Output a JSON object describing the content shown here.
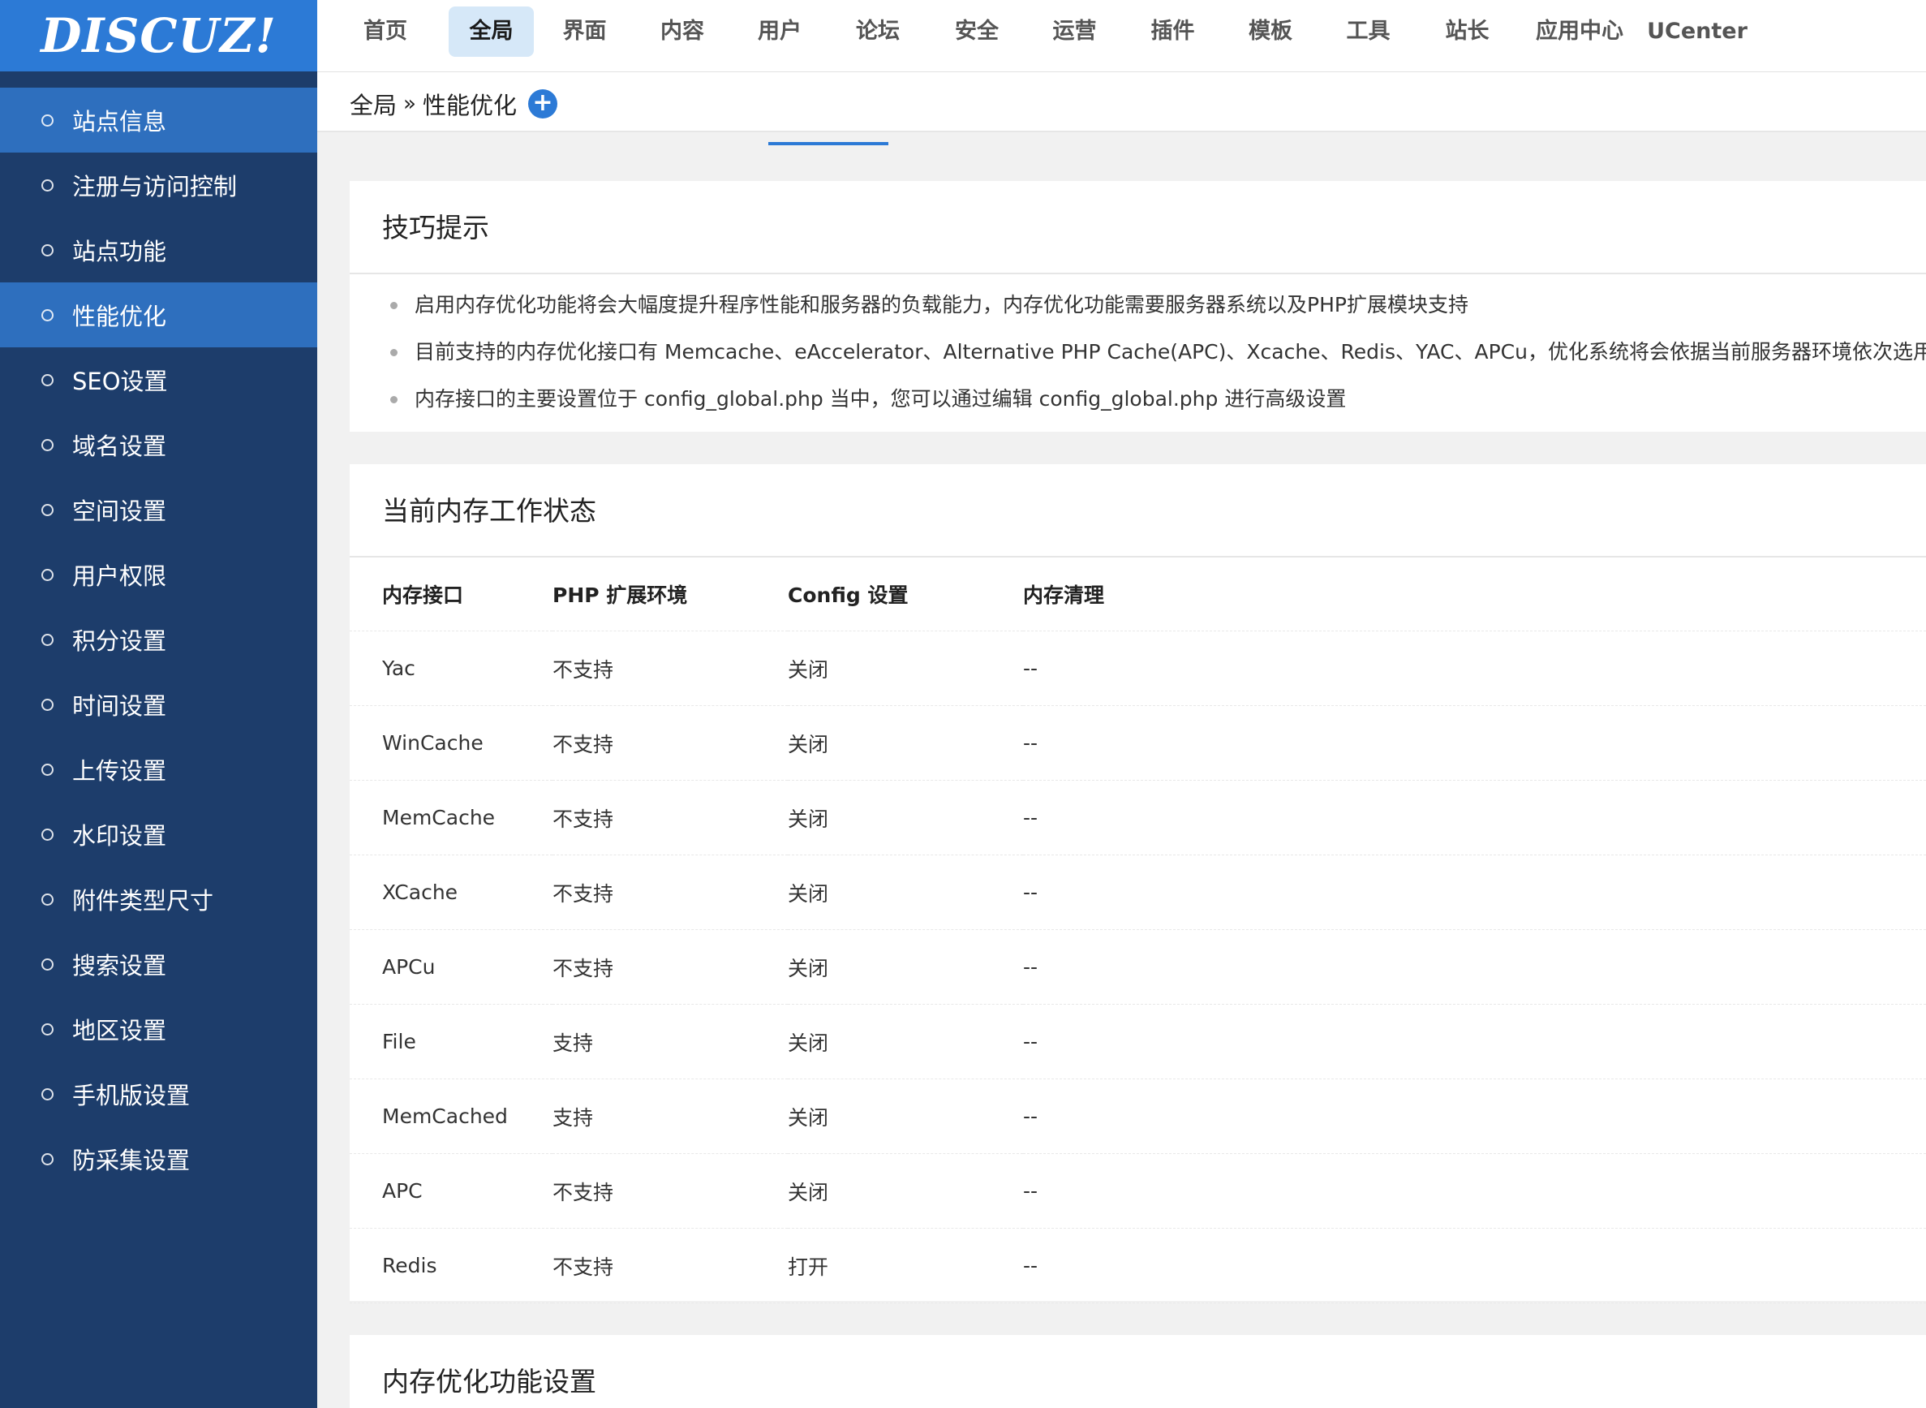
{
  "logo": "DISCUZ!",
  "top_nav": [
    {
      "label": "首页",
      "active": false
    },
    {
      "label": "全局",
      "active": true
    },
    {
      "label": "界面",
      "active": false
    },
    {
      "label": "内容",
      "active": false
    },
    {
      "label": "用户",
      "active": false
    },
    {
      "label": "论坛",
      "active": false
    },
    {
      "label": "安全",
      "active": false
    },
    {
      "label": "运营",
      "active": false
    },
    {
      "label": "插件",
      "active": false
    },
    {
      "label": "模板",
      "active": false
    },
    {
      "label": "工具",
      "active": false
    },
    {
      "label": "站长",
      "active": false
    },
    {
      "label": "应用中心",
      "active": false
    },
    {
      "label": "UCenter",
      "active": false
    }
  ],
  "sidebar": {
    "items": [
      {
        "label": "站点信息",
        "active": true
      },
      {
        "label": "注册与访问控制",
        "active": false
      },
      {
        "label": "站点功能",
        "active": false
      },
      {
        "label": "性能优化",
        "active": true
      },
      {
        "label": "SEO设置",
        "active": false
      },
      {
        "label": "域名设置",
        "active": false
      },
      {
        "label": "空间设置",
        "active": false
      },
      {
        "label": "用户权限",
        "active": false
      },
      {
        "label": "积分设置",
        "active": false
      },
      {
        "label": "时间设置",
        "active": false
      },
      {
        "label": "上传设置",
        "active": false
      },
      {
        "label": "水印设置",
        "active": false
      },
      {
        "label": "附件类型尺寸",
        "active": false
      },
      {
        "label": "搜索设置",
        "active": false
      },
      {
        "label": "地区设置",
        "active": false
      },
      {
        "label": "手机版设置",
        "active": false
      },
      {
        "label": "防采集设置",
        "active": false
      }
    ]
  },
  "breadcrumb": {
    "root": "全局",
    "separator": "»",
    "current": "性能优化"
  },
  "tips": {
    "title": "技巧提示",
    "items": [
      "启用内存优化功能将会大幅度提升程序性能和服务器的负载能力，内存优化功能需要服务器系统以及PHP扩展模块支持",
      "目前支持的内存优化接口有 Memcache、eAccelerator、Alternative PHP Cache(APC)、Xcache、Redis、YAC、APCu，优化系统将会依据当前服务器环境依次选用接口",
      "内存接口的主要设置位于 config_global.php 当中，您可以通过编辑 config_global.php 进行高级设置"
    ]
  },
  "status": {
    "title": "当前内存工作状态",
    "headers": [
      "内存接口",
      "PHP 扩展环境",
      "Config 设置",
      "内存清理"
    ],
    "rows": [
      [
        "Yac",
        "不支持",
        "关闭",
        "--"
      ],
      [
        "WinCache",
        "不支持",
        "关闭",
        "--"
      ],
      [
        "MemCache",
        "不支持",
        "关闭",
        "--"
      ],
      [
        "XCache",
        "不支持",
        "关闭",
        "--"
      ],
      [
        "APCu",
        "不支持",
        "关闭",
        "--"
      ],
      [
        "File",
        "支持",
        "关闭",
        "--"
      ],
      [
        "MemCached",
        "支持",
        "关闭",
        "--"
      ],
      [
        "APC",
        "不支持",
        "关闭",
        "--"
      ],
      [
        "Redis",
        "不支持",
        "打开",
        "--"
      ]
    ]
  },
  "settings": {
    "title": "内存优化功能设置"
  },
  "colors": {
    "brand": "#2c7ad6",
    "sidebar": "#1d3d6b",
    "active": "#2e6fbe"
  }
}
